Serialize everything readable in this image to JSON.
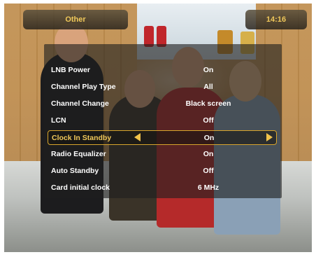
{
  "header": {
    "title": "Other",
    "clock": "14:16"
  },
  "menu": {
    "items": [
      {
        "label": "LNB Power",
        "value": "On"
      },
      {
        "label": "Channel Play Type",
        "value": "All"
      },
      {
        "label": "Channel Change",
        "value": "Black screen"
      },
      {
        "label": "LCN",
        "value": "Off"
      },
      {
        "label": "Clock In Standby",
        "value": "On",
        "selected": true
      },
      {
        "label": "Radio Equalizer",
        "value": "On"
      },
      {
        "label": "Auto Standby",
        "value": "Off"
      },
      {
        "label": "Card initial clock",
        "value": "6 MHz"
      }
    ]
  },
  "colors": {
    "accent": "#f0c85a",
    "selection_border": "#d8a52c",
    "panel": "#1e1e1e"
  },
  "icons": {
    "left_arrow": "triangle-left",
    "right_arrow": "triangle-right"
  }
}
